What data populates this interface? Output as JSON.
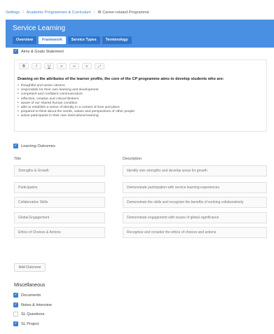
{
  "breadcrumb": {
    "items": [
      "Settings",
      "Academic Programmes & Curriculum",
      "IB Career-related Programme"
    ],
    "separator": "/"
  },
  "header": {
    "title": "Service Learning",
    "tabs": [
      {
        "label": "Overview",
        "active": false
      },
      {
        "label": "Framework",
        "active": true
      },
      {
        "label": "Service Types",
        "active": false
      },
      {
        "label": "Terminology",
        "active": false
      }
    ]
  },
  "aims": {
    "label": "Aims & Goals Statement",
    "checked": true,
    "toolbar": [
      "B",
      "I",
      "U",
      "≡",
      "∞",
      "≡",
      "⤢"
    ],
    "heading": "Drawing on the attributes of the learner profile, the core of the CP programme aims to develop students who are:",
    "items": [
      "thoughtful and active citizens",
      "responsible for their own learning and development",
      "competent and confident communicators",
      "reflective, creative and critical thinkers",
      "aware of our shared human condition",
      "able to establish a sense of identity in a context of time and place",
      "prepared to think about the needs, values and perspectives of other people",
      "active participants in their own intercultural learning."
    ]
  },
  "outcomes": {
    "label": "Learning Outcomes",
    "checked": true,
    "title_header": "Title",
    "description_header": "Description",
    "rows": [
      {
        "title": "Strengths & Growth",
        "description": "Identify own strengths and develop areas for growth"
      },
      {
        "title": "Participation",
        "description": "Demonstrate participation with service learning experiences"
      },
      {
        "title": "Collaborative Skills",
        "description": "Demonstrate the skills and recognize the benefits of working collaboratively"
      },
      {
        "title": "Global Engagement",
        "description": "Demonstrate engagement with issues of global significance"
      },
      {
        "title": "Ethics of Choices & Actions",
        "description": "Recognise and consider the ethics of choices and actions"
      }
    ],
    "add_label": "Add Outcome"
  },
  "misc": {
    "title": "Miscellaneous",
    "options": [
      {
        "label": "Documents",
        "checked": true
      },
      {
        "label": "Notes & Interview",
        "checked": true
      },
      {
        "label": "SL Questions",
        "checked": false
      },
      {
        "label": "SL Project",
        "checked": true
      }
    ]
  },
  "colors": {
    "accent": "#4a90e2",
    "tab_dark": "#2f74c9",
    "checkbox": "#3d7fd0"
  }
}
